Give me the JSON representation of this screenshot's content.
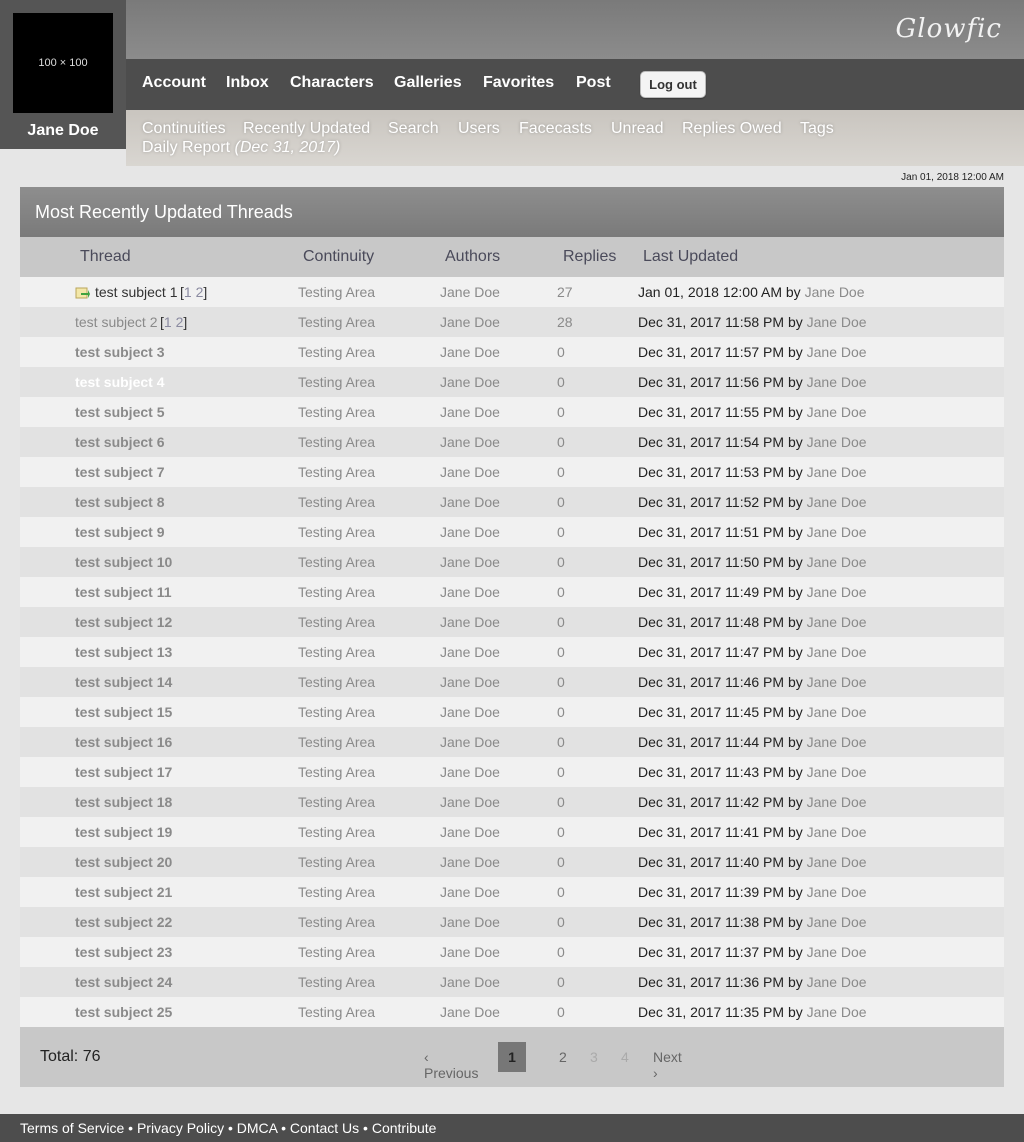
{
  "brand": {
    "logo": "Glowfic"
  },
  "user": {
    "avatar_text": "100 × 100",
    "name": "Jane Doe"
  },
  "nav": {
    "main": [
      "Account",
      "Inbox",
      "Characters",
      "Galleries",
      "Favorites",
      "Post"
    ],
    "logout_label": "Log out",
    "sub": [
      "Continuities",
      "Recently Updated",
      "Search",
      "Users",
      "Facecasts",
      "Unread",
      "Replies Owed",
      "Tags"
    ],
    "daily_report": "Daily Report",
    "daily_date": "(Dec 31, 2017)"
  },
  "timestamp": "Jan 01, 2018 12:00 AM",
  "panel": {
    "title": "Most Recently Updated Threads",
    "columns": [
      "Thread",
      "Continuity",
      "Authors",
      "Replies",
      "Last Updated"
    ]
  },
  "threads": [
    {
      "title": "test subject 1",
      "pages": [
        "1",
        "2"
      ],
      "continuity": "Testing Area",
      "authors": "Jane Doe",
      "replies": "27",
      "updated": "Jan 01, 2018 12:00 AM",
      "by": "by",
      "updater": "Jane Doe",
      "unread_icon": "unread-arrow-icon"
    },
    {
      "title": "test subject 2",
      "pages": [
        "1",
        "2"
      ],
      "continuity": "Testing Area",
      "authors": "Jane Doe",
      "replies": "28",
      "updated": "Dec 31, 2017 11:58 PM",
      "by": "by",
      "updater": "Jane Doe"
    },
    {
      "title": "test subject 3",
      "continuity": "Testing Area",
      "authors": "Jane Doe",
      "replies": "0",
      "updated": "Dec 31, 2017 11:57 PM",
      "by": "by",
      "updater": "Jane Doe"
    },
    {
      "title": "test subject 4",
      "continuity": "Testing Area",
      "authors": "Jane Doe",
      "replies": "0",
      "updated": "Dec 31, 2017 11:56 PM",
      "by": "by",
      "updater": "Jane Doe"
    },
    {
      "title": "test subject 5",
      "continuity": "Testing Area",
      "authors": "Jane Doe",
      "replies": "0",
      "updated": "Dec 31, 2017 11:55 PM",
      "by": "by",
      "updater": "Jane Doe"
    },
    {
      "title": "test subject 6",
      "continuity": "Testing Area",
      "authors": "Jane Doe",
      "replies": "0",
      "updated": "Dec 31, 2017 11:54 PM",
      "by": "by",
      "updater": "Jane Doe"
    },
    {
      "title": "test subject 7",
      "continuity": "Testing Area",
      "authors": "Jane Doe",
      "replies": "0",
      "updated": "Dec 31, 2017 11:53 PM",
      "by": "by",
      "updater": "Jane Doe"
    },
    {
      "title": "test subject 8",
      "continuity": "Testing Area",
      "authors": "Jane Doe",
      "replies": "0",
      "updated": "Dec 31, 2017 11:52 PM",
      "by": "by",
      "updater": "Jane Doe"
    },
    {
      "title": "test subject 9",
      "continuity": "Testing Area",
      "authors": "Jane Doe",
      "replies": "0",
      "updated": "Dec 31, 2017 11:51 PM",
      "by": "by",
      "updater": "Jane Doe"
    },
    {
      "title": "test subject 10",
      "continuity": "Testing Area",
      "authors": "Jane Doe",
      "replies": "0",
      "updated": "Dec 31, 2017 11:50 PM",
      "by": "by",
      "updater": "Jane Doe"
    },
    {
      "title": "test subject 11",
      "continuity": "Testing Area",
      "authors": "Jane Doe",
      "replies": "0",
      "updated": "Dec 31, 2017 11:49 PM",
      "by": "by",
      "updater": "Jane Doe"
    },
    {
      "title": "test subject 12",
      "continuity": "Testing Area",
      "authors": "Jane Doe",
      "replies": "0",
      "updated": "Dec 31, 2017 11:48 PM",
      "by": "by",
      "updater": "Jane Doe"
    },
    {
      "title": "test subject 13",
      "continuity": "Testing Area",
      "authors": "Jane Doe",
      "replies": "0",
      "updated": "Dec 31, 2017 11:47 PM",
      "by": "by",
      "updater": "Jane Doe"
    },
    {
      "title": "test subject 14",
      "continuity": "Testing Area",
      "authors": "Jane Doe",
      "replies": "0",
      "updated": "Dec 31, 2017 11:46 PM",
      "by": "by",
      "updater": "Jane Doe"
    },
    {
      "title": "test subject 15",
      "continuity": "Testing Area",
      "authors": "Jane Doe",
      "replies": "0",
      "updated": "Dec 31, 2017 11:45 PM",
      "by": "by",
      "updater": "Jane Doe"
    },
    {
      "title": "test subject 16",
      "continuity": "Testing Area",
      "authors": "Jane Doe",
      "replies": "0",
      "updated": "Dec 31, 2017 11:44 PM",
      "by": "by",
      "updater": "Jane Doe"
    },
    {
      "title": "test subject 17",
      "continuity": "Testing Area",
      "authors": "Jane Doe",
      "replies": "0",
      "updated": "Dec 31, 2017 11:43 PM",
      "by": "by",
      "updater": "Jane Doe"
    },
    {
      "title": "test subject 18",
      "continuity": "Testing Area",
      "authors": "Jane Doe",
      "replies": "0",
      "updated": "Dec 31, 2017 11:42 PM",
      "by": "by",
      "updater": "Jane Doe"
    },
    {
      "title": "test subject 19",
      "continuity": "Testing Area",
      "authors": "Jane Doe",
      "replies": "0",
      "updated": "Dec 31, 2017 11:41 PM",
      "by": "by",
      "updater": "Jane Doe"
    },
    {
      "title": "test subject 20",
      "continuity": "Testing Area",
      "authors": "Jane Doe",
      "replies": "0",
      "updated": "Dec 31, 2017 11:40 PM",
      "by": "by",
      "updater": "Jane Doe"
    },
    {
      "title": "test subject 21",
      "continuity": "Testing Area",
      "authors": "Jane Doe",
      "replies": "0",
      "updated": "Dec 31, 2017 11:39 PM",
      "by": "by",
      "updater": "Jane Doe"
    },
    {
      "title": "test subject 22",
      "continuity": "Testing Area",
      "authors": "Jane Doe",
      "replies": "0",
      "updated": "Dec 31, 2017 11:38 PM",
      "by": "by",
      "updater": "Jane Doe"
    },
    {
      "title": "test subject 23",
      "continuity": "Testing Area",
      "authors": "Jane Doe",
      "replies": "0",
      "updated": "Dec 31, 2017 11:37 PM",
      "by": "by",
      "updater": "Jane Doe"
    },
    {
      "title": "test subject 24",
      "continuity": "Testing Area",
      "authors": "Jane Doe",
      "replies": "0",
      "updated": "Dec 31, 2017 11:36 PM",
      "by": "by",
      "updater": "Jane Doe"
    },
    {
      "title": "test subject 25",
      "continuity": "Testing Area",
      "authors": "Jane Doe",
      "replies": "0",
      "updated": "Dec 31, 2017 11:35 PM",
      "by": "by",
      "updater": "Jane Doe"
    }
  ],
  "pagination": {
    "total": "Total: 76",
    "prev": "‹ Previous",
    "pages": [
      "1",
      "2",
      "3",
      "4"
    ],
    "current": "1",
    "next": "Next ›"
  },
  "footer": {
    "links": [
      "Terms of Service",
      "Privacy Policy",
      "DMCA",
      "Contact Us",
      "Contribute"
    ],
    "separator": "•"
  },
  "colors": {
    "header_dark": "#4d4d4d",
    "panel_title": "#858585",
    "row_light": "#f1f1f1",
    "row_dark": "#e2e2e2",
    "link_gray": "#8a8a8a"
  }
}
